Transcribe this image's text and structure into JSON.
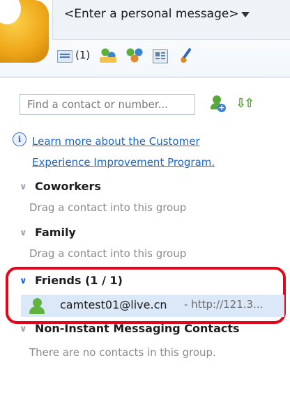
{
  "header": {
    "personal_message": "<Enter a personal message>",
    "mail_count": "(1)"
  },
  "search": {
    "placeholder": "Find a contact or number..."
  },
  "ceip": {
    "line1": "Learn more about the Customer",
    "line2": "Experience Improvement Program."
  },
  "groups": [
    {
      "label": "Coworkers",
      "empty_text": "Drag a contact into this group"
    },
    {
      "label": "Family",
      "empty_text": "Drag a contact into this group"
    },
    {
      "label": "Friends",
      "count": "(1 / 1)"
    },
    {
      "label": "Non-Instant Messaging Contacts",
      "empty_text": "There are no contacts in this group."
    }
  ],
  "contacts": [
    {
      "email": "camtest01@live.cn",
      "message": "- http://121.3..."
    }
  ],
  "colors": {
    "highlight": "#e3061a",
    "link": "#1a63c7",
    "online": "#5fb33e"
  }
}
